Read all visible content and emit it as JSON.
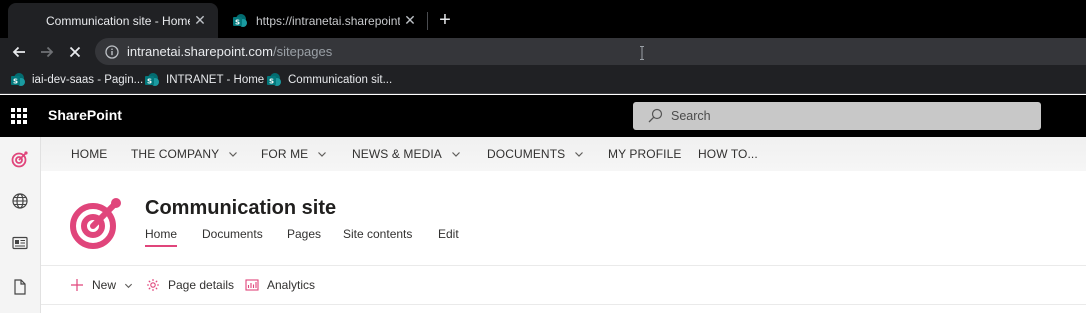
{
  "browser": {
    "tabs": [
      {
        "title": "Communication site - Home",
        "active": true
      },
      {
        "title": "https://intranetai.sharepoint.com",
        "active": false
      }
    ],
    "address": {
      "host": "intranetai.sharepoint.com",
      "path": "/sitepages"
    },
    "bookmarks": [
      {
        "label": "iai-dev-saas - Pagin..."
      },
      {
        "label": "INTRANET - Home"
      },
      {
        "label": "Communication sit..."
      }
    ]
  },
  "suitebar": {
    "app_name": "SharePoint",
    "search_placeholder": "Search"
  },
  "hubnav": {
    "items": [
      {
        "label": "HOME",
        "has_menu": false
      },
      {
        "label": "THE COMPANY",
        "has_menu": true
      },
      {
        "label": "FOR ME",
        "has_menu": true
      },
      {
        "label": "NEWS & MEDIA",
        "has_menu": true
      },
      {
        "label": "DOCUMENTS",
        "has_menu": true
      },
      {
        "label": "MY PROFILE",
        "has_menu": false
      },
      {
        "label": "HOW TO...",
        "has_menu": false
      }
    ]
  },
  "site": {
    "title": "Communication site",
    "nav": [
      {
        "label": "Home",
        "active": true
      },
      {
        "label": "Documents",
        "active": false
      },
      {
        "label": "Pages",
        "active": false
      },
      {
        "label": "Site contents",
        "active": false
      },
      {
        "label": "Edit",
        "active": false
      }
    ]
  },
  "commandbar": {
    "new_label": "New",
    "page_details_label": "Page details",
    "analytics_label": "Analytics"
  },
  "colors": {
    "accent": "#e0457b",
    "suite_bg": "#000000",
    "chrome_bg": "#202124"
  }
}
